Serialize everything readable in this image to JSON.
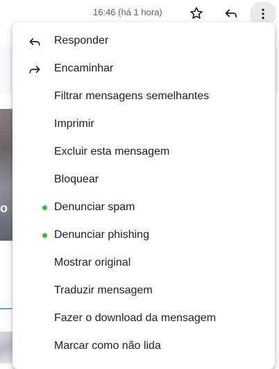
{
  "header": {
    "timestamp": "16:46 (há 1 hora)",
    "star_icon": "star-outline-icon",
    "reply_icon": "reply-icon",
    "more_icon": "more-vertical-icon"
  },
  "background": {
    "partial_text": "o"
  },
  "menu": {
    "items": [
      {
        "label": "Responder",
        "icon": "reply-icon"
      },
      {
        "label": "Encaminhar",
        "icon": "forward-icon"
      },
      {
        "label": "Filtrar mensagens semelhantes"
      },
      {
        "label": "Imprimir"
      },
      {
        "label": "Excluir esta mensagem"
      },
      {
        "label": "Bloquear"
      },
      {
        "label": "Denunciar spam",
        "icon": "green-dot-icon"
      },
      {
        "label": "Denunciar phishing",
        "icon": "green-dot-icon"
      },
      {
        "label": "Mostrar original"
      },
      {
        "label": "Traduzir mensagem"
      },
      {
        "label": "Fazer o download da mensagem"
      },
      {
        "label": "Marcar como não lida"
      }
    ]
  },
  "colors": {
    "indicator_dot": "#38c22b",
    "more_button_bg": "#e8eaed"
  }
}
